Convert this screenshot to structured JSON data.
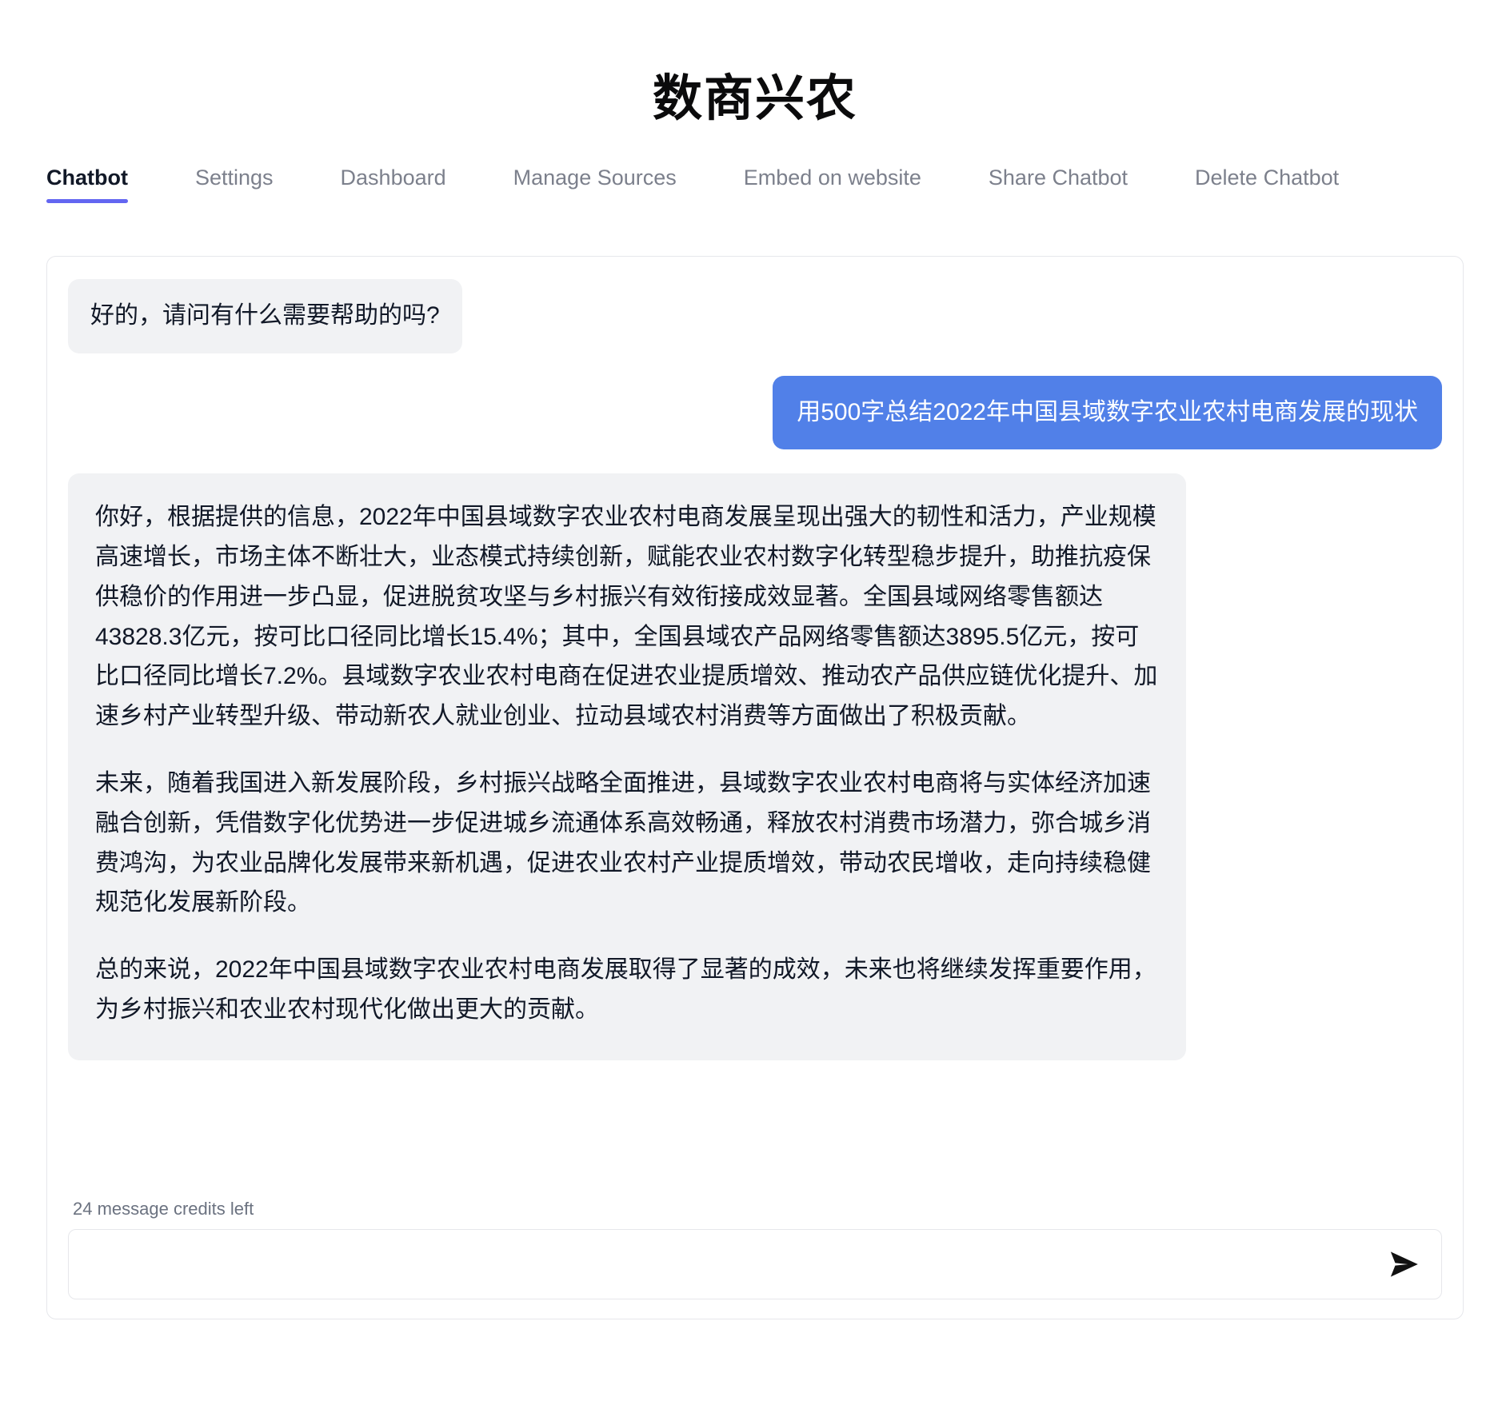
{
  "header": {
    "title": "数商兴农"
  },
  "tabs": [
    {
      "label": "Chatbot",
      "active": true
    },
    {
      "label": "Settings",
      "active": false
    },
    {
      "label": "Dashboard",
      "active": false
    },
    {
      "label": "Manage Sources",
      "active": false
    },
    {
      "label": "Embed on website",
      "active": false
    },
    {
      "label": "Share Chatbot",
      "active": false
    },
    {
      "label": "Delete Chatbot",
      "active": false
    }
  ],
  "chat": {
    "greeting": "好的，请问有什么需要帮助的吗?",
    "user_message": "用500字总结2022年中国县域数字农业农村电商发展的现状",
    "bot_reply": {
      "p1": "你好，根据提供的信息，2022年中国县域数字农业农村电商发展呈现出强大的韧性和活力，产业规模高速增长，市场主体不断壮大，业态模式持续创新，赋能农业农村数字化转型稳步提升，助推抗疫保供稳价的作用进一步凸显，促进脱贫攻坚与乡村振兴有效衔接成效显著。全国县域网络零售额达43828.3亿元，按可比口径同比增长15.4%；其中，全国县域农产品网络零售额达3895.5亿元，按可比口径同比增长7.2%。县域数字农业农村电商在促进农业提质增效、推动农产品供应链优化提升、加速乡村产业转型升级、带动新农人就业创业、拉动县域农村消费等方面做出了积极贡献。",
      "p2": "未来，随着我国进入新发展阶段，乡村振兴战略全面推进，县域数字农业农村电商将与实体经济加速融合创新，凭借数字化优势进一步促进城乡流通体系高效畅通，释放农村消费市场潜力，弥合城乡消费鸿沟，为农业品牌化发展带来新机遇，促进农业农村产业提质增效，带动农民增收，走向持续稳健规范化发展新阶段。",
      "p3": "总的来说，2022年中国县域数字农业农村电商发展取得了显著的成效，未来也将继续发挥重要作用，为乡村振兴和农业农村现代化做出更大的贡献。"
    }
  },
  "composer": {
    "credits": "24 message credits left",
    "input_value": "",
    "input_placeholder": "",
    "send_icon": "send-paper-plane-icon"
  },
  "colors": {
    "accent": "#6366f1",
    "user_bubble": "#5180e8",
    "bot_bubble": "#f1f2f4",
    "border": "#e6e7eb",
    "muted_text": "#7c808c"
  }
}
